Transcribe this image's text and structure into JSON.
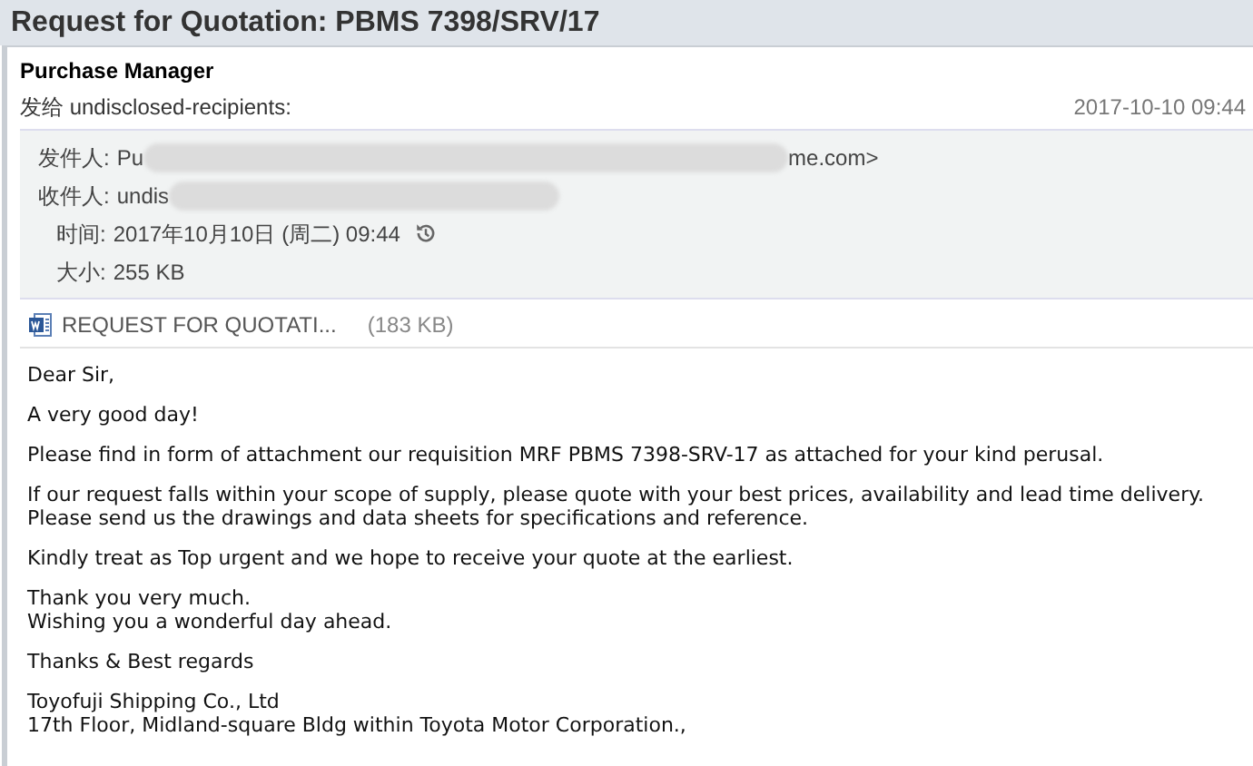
{
  "subject": "Request for Quotation: PBMS 7398/SRV/17",
  "sender": "Purchase Manager",
  "recipients": "发给 undisclosed-recipients:",
  "date": "2017-10-10 09:44",
  "details": [
    {
      "kind": "redacted",
      "label": "发件人:",
      "start": "Pu",
      "end": "me.com>"
    },
    {
      "kind": "redacted",
      "label": "收件人:",
      "start": "undis"
    },
    {
      "kind": "time",
      "label": "时间:",
      "value": "2017年10月10日 (周二) 09:44"
    },
    {
      "kind": "plain",
      "label": "大小:",
      "value": "255 KB"
    }
  ],
  "attachment": {
    "name": "REQUEST FOR QUOTATI...",
    "size": "(183 KB)"
  },
  "body": [
    [
      "Dear Sir,"
    ],
    [
      "A very good day!"
    ],
    [
      "Please find in form of attachment our requisition MRF PBMS 7398-SRV-17 as attached for your kind perusal."
    ],
    [
      "If our request falls within your scope of supply, please quote with your best prices, availability and lead time delivery.",
      "Please send us the drawings and data sheets for specifications and reference."
    ],
    [
      "Kindly treat as Top urgent and we hope to receive your quote at the earliest."
    ],
    [
      "Thank you very much.",
      "Wishing you a wonderful day ahead."
    ],
    [
      "Thanks & Best regards"
    ],
    [
      "Toyofuji Shipping Co., Ltd",
      "17th Floor, Midland-square Bldg within Toyota Motor Corporation.,"
    ]
  ]
}
